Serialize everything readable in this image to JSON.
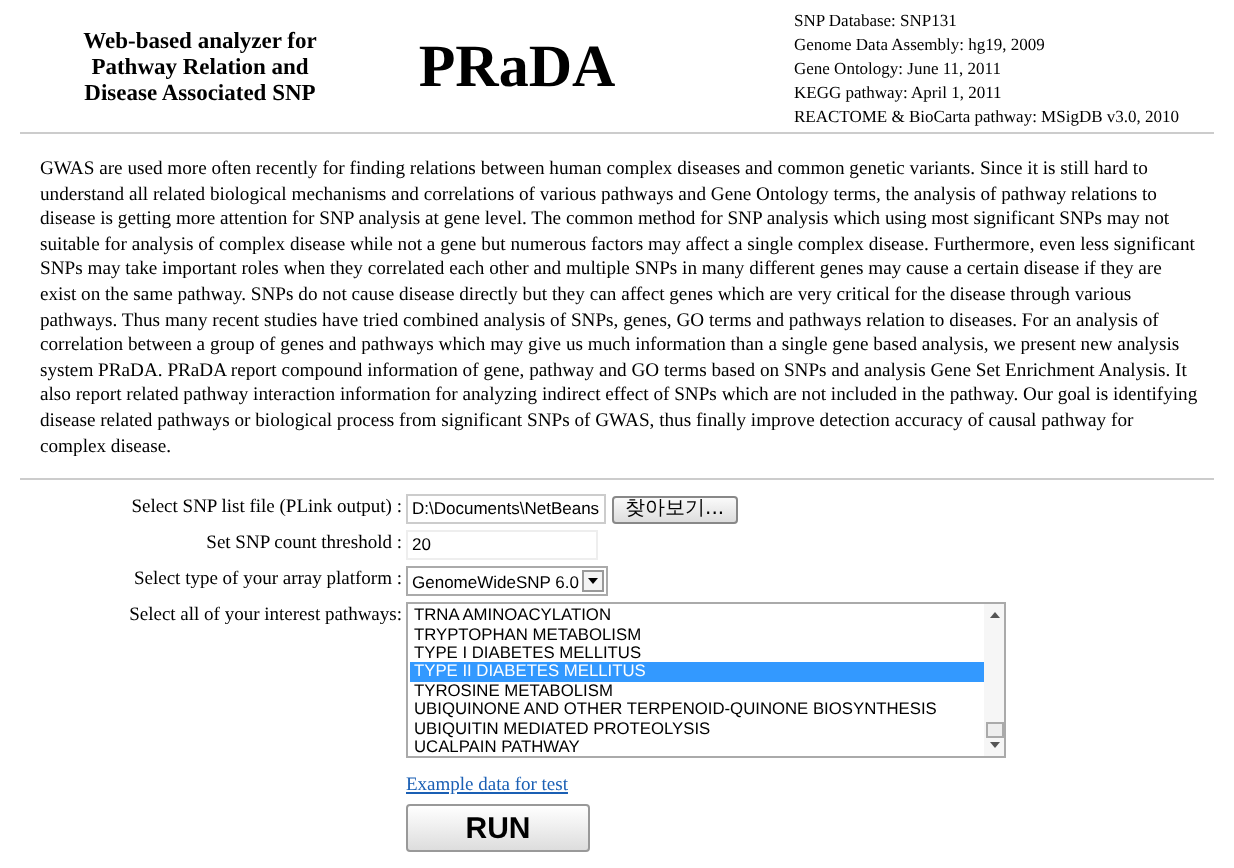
{
  "header": {
    "subtitle_lines": [
      "Web-based analyzer for",
      "Pathway Relation and",
      "Disease Associated SNP"
    ],
    "logo": "PRaDA",
    "info_lines": [
      "SNP Database: SNP131",
      "Genome Data Assembly: hg19, 2009",
      "Gene Ontology: June 11, 2011",
      "KEGG pathway: April 1, 2011",
      "REACTOME & BioCarta pathway: MSigDB v3.0, 2010"
    ]
  },
  "description": "GWAS are used more often recently for finding relations between human complex diseases and common genetic variants. Since it is still hard to understand all related biological mechanisms and correlations of various pathways and Gene Ontology terms, the analysis of pathway relations to disease is getting more attention for SNP analysis at gene level. The common method for SNP analysis which using most significant SNPs may not suitable for analysis of complex disease while not a gene but numerous factors may affect a single complex disease. Furthermore, even less significant SNPs may take important roles when they correlated each other and multiple SNPs in many different genes may cause a certain disease if they are exist on the same pathway. SNPs do not cause disease directly but they can affect genes which are very critical for the disease through various pathways. Thus many recent studies have tried combined analysis of SNPs, genes, GO terms and pathways relation to diseases. For an analysis of correlation between a group of genes and pathways which may give us much information than a single gene based analysis, we present new analysis system PRaDA. PRaDA report compound information of gene, pathway and GO terms based on SNPs and analysis Gene Set Enrichment Analysis. It also report related pathway interaction information for analyzing indirect effect of SNPs which are not included in the pathway. Our goal is identifying disease related pathways or biological process from significant SNPs of GWAS, thus finally improve detection accuracy of causal pathway for complex disease.",
  "form": [
    {
      "kind": "file",
      "label": "Select SNP list file (PLink output) :",
      "value": "D:\\Documents\\NetBeans",
      "button": "찾아보기..."
    },
    {
      "kind": "text",
      "label": "Set SNP count threshold :",
      "value": "20"
    },
    {
      "kind": "select",
      "label": "Select type of your array platform :",
      "value": "GenomeWideSNP 6.0"
    },
    {
      "kind": "listbox",
      "label": "Select all of your interest pathways:",
      "options": [
        {
          "label": "TRNA AMINOACYLATION",
          "selected": false
        },
        {
          "label": "TRYPTOPHAN METABOLISM",
          "selected": false
        },
        {
          "label": "TYPE I DIABETES MELLITUS",
          "selected": false
        },
        {
          "label": "TYPE II DIABETES MELLITUS",
          "selected": true
        },
        {
          "label": "TYROSINE METABOLISM",
          "selected": false
        },
        {
          "label": "UBIQUINONE AND OTHER TERPENOID-QUINONE BIOSYNTHESIS",
          "selected": false
        },
        {
          "label": "UBIQUITIN MEDIATED PROTEOLYSIS",
          "selected": false
        },
        {
          "label": "UCALPAIN PATHWAY",
          "selected": false
        }
      ]
    }
  ],
  "example_link": "Example data for test",
  "run_button": "RUN"
}
